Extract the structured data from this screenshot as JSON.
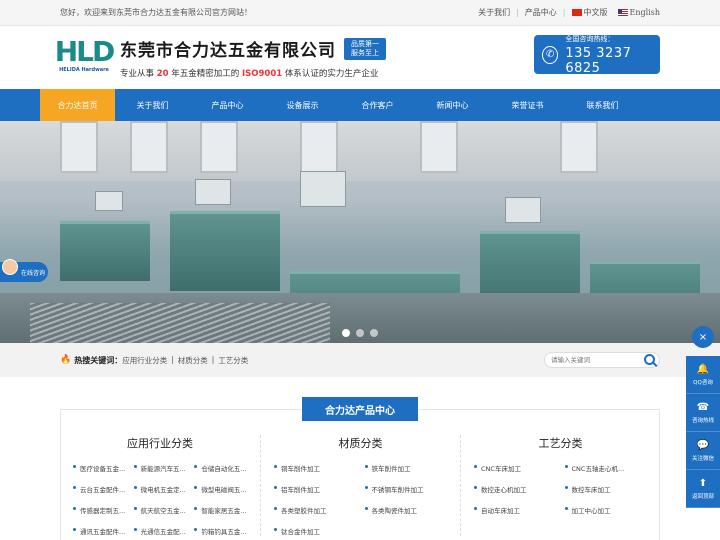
{
  "topbar": {
    "welcome": "您好，欢迎来到东莞市合力达五金有限公司官方网站！",
    "links": [
      "关于我们",
      "产品中心"
    ],
    "lang_cn": "中文版",
    "lang_en": "English"
  },
  "header": {
    "logo_mark": "HLD",
    "logo_sub": "HELIDA Hardware",
    "company": "东莞市合力达五金有限公司",
    "badge_line1": "品质第一",
    "badge_line2": "服务至上",
    "tagline_pre": "专业从事",
    "tagline_num": "20",
    "tagline_mid": "年五金精密加工的",
    "tagline_iso": "ISO9001",
    "tagline_post": "体系认证的实力生产企业",
    "hotline_label": "全国咨询热线：",
    "hotline_number": "135 3237 6825"
  },
  "nav": {
    "items": [
      "合力达首页",
      "关于我们",
      "产品中心",
      "设备展示",
      "合作客户",
      "新闻中心",
      "荣誉证书",
      "联系我们"
    ],
    "active_index": 0
  },
  "service": {
    "label": "在线咨询"
  },
  "keywords": {
    "label": "热搜关键词：",
    "links": [
      "应用行业分类",
      "材质分类",
      "工艺分类"
    ],
    "search_placeholder": "请输入关键词"
  },
  "products": {
    "title": "合力达产品中心",
    "columns": [
      {
        "title": "应用行业分类",
        "items": [
          "医疗设备五金...",
          "新能源汽车五...",
          "仓储自动化五...",
          "云台五金配件...",
          "微电机五金定...",
          "微型电磁阀五...",
          "传感器定制五...",
          "航天航空五金...",
          "智能家居五金...",
          "通讯五金配件...",
          "光通信五金配...",
          "钓箱钓具五金..."
        ]
      },
      {
        "title": "材质分类",
        "items": [
          "铜车削件加工",
          "铁车削件加工",
          "铝车削件加工",
          "不锈钢车削件加工",
          "各类塑胶件加工",
          "各类陶瓷件加工",
          "钛合金件加工"
        ]
      },
      {
        "title": "工艺分类",
        "items": [
          "CNC车床加工",
          "CNC五轴走心机...",
          "数控走心机加工",
          "数控车床加工",
          "自动车床加工",
          "加工中心加工"
        ]
      }
    ]
  },
  "sidebar": {
    "close": "×",
    "items": [
      {
        "label": "QQ咨询",
        "icon": "🔔"
      },
      {
        "label": "咨询热线",
        "icon": "☎"
      },
      {
        "label": "关注微信",
        "icon": "💬"
      },
      {
        "label": "返回顶部",
        "icon": "⬆"
      }
    ]
  },
  "colors": {
    "primary": "#1e6fc2",
    "accent": "#f5a623",
    "highlight": "#ee3333"
  }
}
